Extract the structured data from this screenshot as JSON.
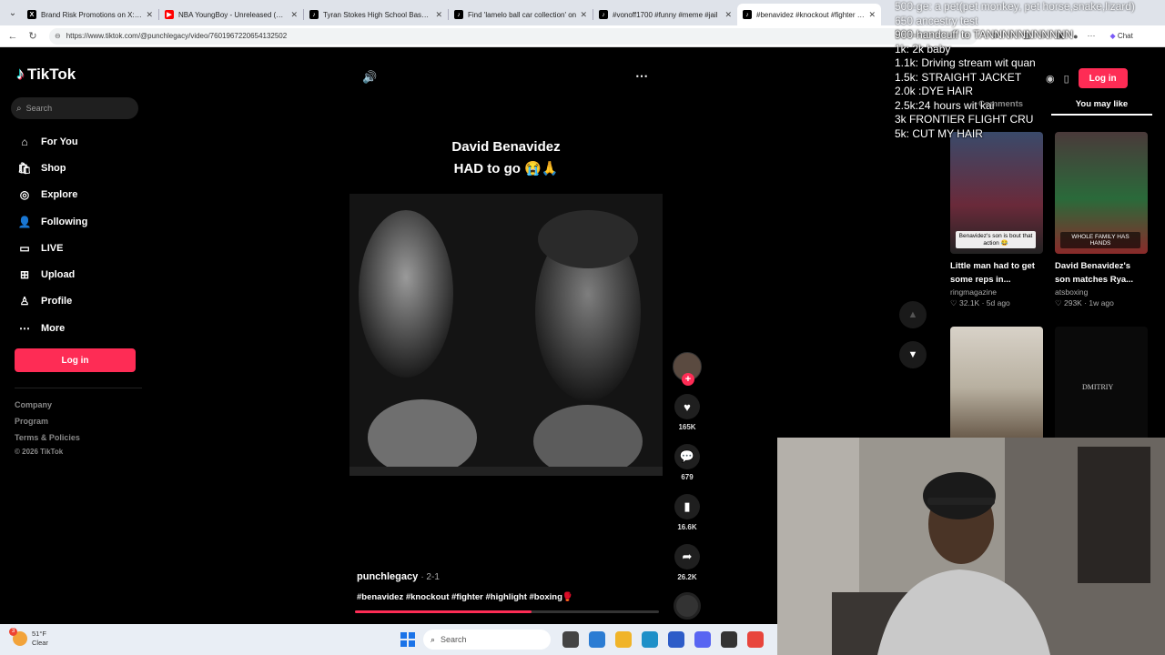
{
  "browser": {
    "tabs": [
      {
        "title": "Brand Risk Promotions on X: \"Bra",
        "favicon": "x-logo",
        "color": "#000000"
      },
      {
        "title": "NBA YoungBoy - Unreleased (LIVE)",
        "favicon": "youtube",
        "color": "#ff0000"
      },
      {
        "title": "Tyran Stokes High School Basketb",
        "favicon": "tiktok",
        "color": "#000000"
      },
      {
        "title": "Find 'lamelo ball car collection' on",
        "favicon": "tiktok",
        "color": "#000000"
      },
      {
        "title": "#vonoff1700 #funny #meme #jail",
        "favicon": "tiktok",
        "color": "#000000"
      },
      {
        "title": "#benavidez #knockout #fighter #hi",
        "favicon": "tiktok",
        "color": "#000000",
        "active": true
      }
    ],
    "url": "https://www.tiktok.com/@punchlegacy/video/7601967220654132502",
    "chat_label": "Chat"
  },
  "sidebar": {
    "brand": "TikTok",
    "search_placeholder": "Search",
    "items": [
      {
        "label": "For You",
        "icon": "home-icon"
      },
      {
        "label": "Shop",
        "icon": "shop-icon"
      },
      {
        "label": "Explore",
        "icon": "compass-icon"
      },
      {
        "label": "Following",
        "icon": "following-icon"
      },
      {
        "label": "LIVE",
        "icon": "live-icon"
      },
      {
        "label": "Upload",
        "icon": "upload-icon"
      },
      {
        "label": "Profile",
        "icon": "profile-icon"
      },
      {
        "label": "More",
        "icon": "more-icon"
      }
    ],
    "login_label": "Log in",
    "footer": [
      "Company",
      "Program",
      "Terms & Policies"
    ],
    "copyright": "© 2026 TikTok"
  },
  "video": {
    "caption_line1": "David Benavidez",
    "caption_line2": "HAD to go 😭🙏",
    "author": "punchlegacy",
    "date": "· 2-1",
    "hashtags": "#benavidez #knockout #fighter #highlight #boxing🥊",
    "likes": "165K",
    "comments": "679",
    "saves": "16.6K",
    "shares": "26.2K",
    "progress": 0.58
  },
  "right": {
    "login_label": "Log in",
    "tab_comments": "Comments",
    "tab_you_may_like": "You may like",
    "cards": [
      {
        "title": "Little man had to get some reps in...",
        "user": "ringmagazine",
        "likes": "32.1K",
        "age": "5d ago",
        "overlay": "Benavidez's son is bout that action 😂"
      },
      {
        "title": "David Benavidez's son matches Rya...",
        "user": "atsboxing",
        "likes": "293K",
        "age": "1w ago",
        "overlay": "WHOLE FAMILY HAS HANDS"
      },
      {
        "title": "",
        "user": "",
        "likes": "",
        "age": "",
        "overlay": ""
      },
      {
        "title": "",
        "user": "",
        "likes": "",
        "age": "",
        "overlay": "DMITRIY"
      }
    ]
  },
  "stream_overlay": [
    "500-ge: a pet(pet monkey, pet horse,snake,lizard)",
    "650 ancestry test",
    "900-handcuff to TANNNNNNNNNNN",
    "1k: 2k baby",
    "1.1k: Driving stream wit quan",
    "1.5k: STRAIGHT JACKET",
    "2.0k :DYE HAIR",
    "2.5k:24 hours wit kai",
    "3k FRONTIER FLIGHT CRU",
    "5k: CUT MY HAIR"
  ],
  "taskbar": {
    "temp": "51°F",
    "weather": "Clear",
    "weather_badge": "3",
    "search_placeholder": "Search"
  }
}
